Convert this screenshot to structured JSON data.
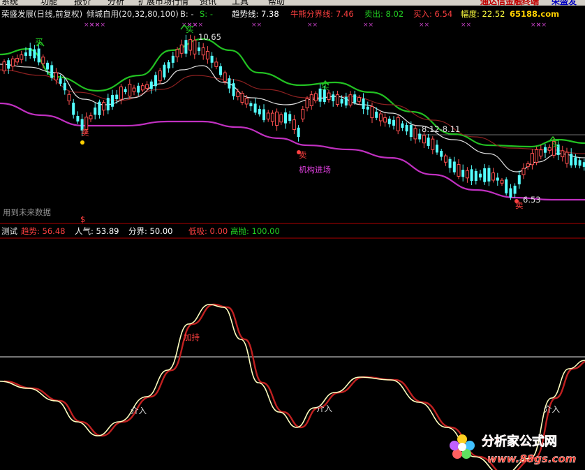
{
  "menubar": {
    "items": [
      "系统",
      "功能",
      "报价",
      "分析",
      "扩展市场行情",
      "资讯",
      "工具",
      "帮助"
    ],
    "right_text": "通达信金融终端",
    "right_text2": "荣盛发"
  },
  "main_panel": {
    "title": "荣盛发展(日线,前复权)",
    "indicator_name": "倾城自用(20,32,80,100)",
    "b_label": "B: -",
    "s_label": "S: -",
    "trend_label": "趋势线: 7.38",
    "bull_bear_label": "牛熊分界线: 7.46",
    "sell_label": "卖出: 8.02",
    "buy_label": "买入: 6.54",
    "amplitude_label": "幅度: 22.52",
    "watermark": "65188.com",
    "high_price": "10.65",
    "low_price": "6.53",
    "mid_label": "8.12-8.11",
    "annot_buy": "买",
    "annot_sell": "卖",
    "institution_label": "机构进场",
    "future_data_note": "用到未来数据",
    "dollar_mark": "$"
  },
  "sub_panel": {
    "name": "测试",
    "trend": "趋势: 56.48",
    "popularity": "人气: 53.89",
    "divider": "分界: 50.00",
    "low_absorb": "低吸: 0.00",
    "high_throw": "高抛: 100.00",
    "label_add": "加持",
    "label_enter": "介入"
  },
  "logo": {
    "text": "分析家公式网",
    "url": "www.88gs.com"
  },
  "colors": {
    "background": "#000000",
    "green_band": "#22c022",
    "magenta_band": "#c030c0",
    "white_line": "#e0e0e0",
    "brown_line": "#8b2020",
    "up_candle": "#ff5050",
    "down_candle": "#54ffff",
    "osc_red": "#c02020",
    "osc_yellow": "#ffffc0"
  }
}
